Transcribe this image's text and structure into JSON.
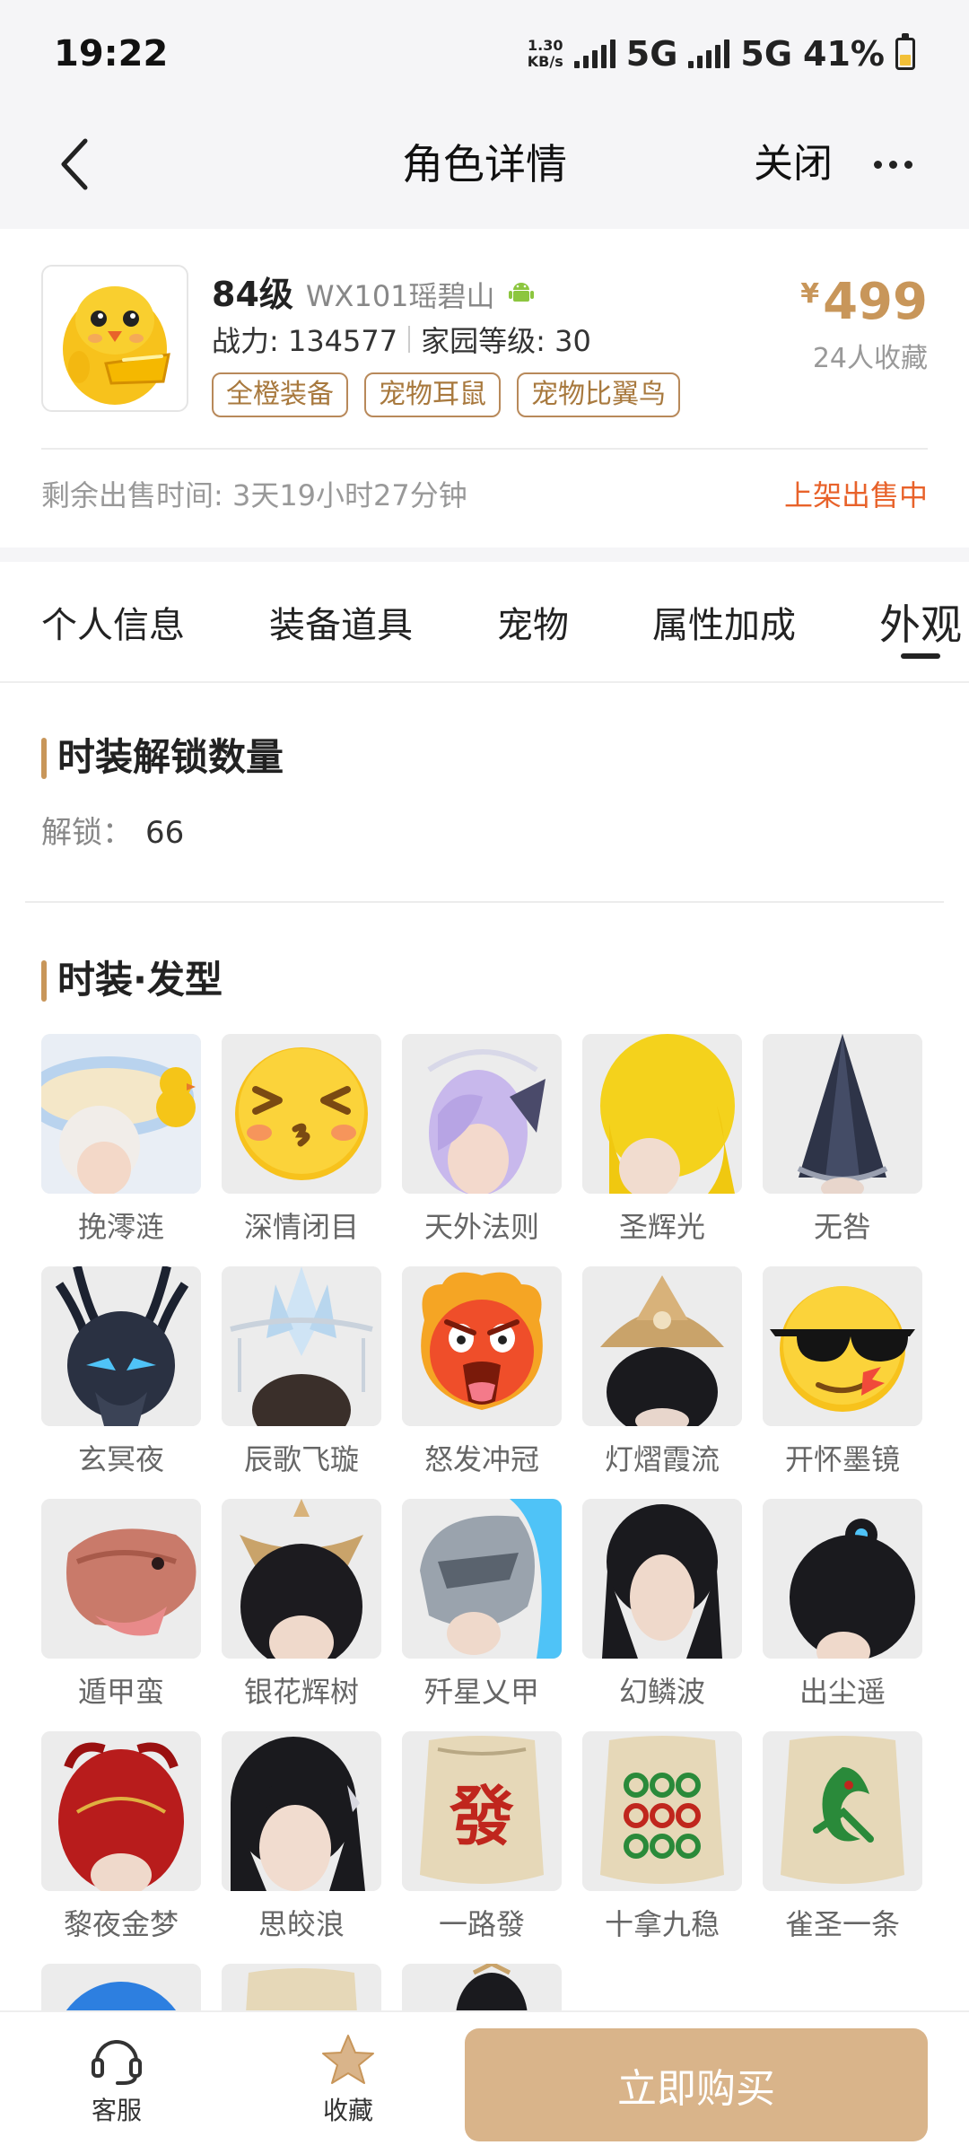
{
  "status_bar": {
    "time": "19:22",
    "net_speed_value": "1.30",
    "net_speed_unit": "KB/s",
    "network_1": "5G",
    "network_2": "5G",
    "battery": "41%"
  },
  "nav": {
    "title": "角色详情",
    "close_label": "关闭"
  },
  "character": {
    "level": "84级",
    "server": "WX101瑶碧山",
    "power": "战力: 134577",
    "home_level": "家园等级: 30",
    "tags": [
      "全橙装备",
      "宠物耳鼠",
      "宠物比翼鸟"
    ],
    "price_symbol": "¥",
    "price": "499",
    "favorites": "24人收藏",
    "remaining_time": "剩余出售时间: 3天19小时27分钟",
    "sale_status": "上架出售中"
  },
  "tabs": [
    "个人信息",
    "装备道具",
    "宠物",
    "属性加成",
    "外观"
  ],
  "active_tab": "外观",
  "unlock_section": {
    "title": "时装解锁数量",
    "label": "解锁：",
    "value": "66"
  },
  "hair_section": {
    "title": "时装·发型",
    "items": [
      "挽澪涟",
      "深情闭目",
      "天外法则",
      "圣辉光",
      "无咎",
      "玄冥夜",
      "辰歌飞璇",
      "怒发冲冠",
      "灯熠霞流",
      "开怀墨镜",
      "遁甲蛮",
      "银花辉树",
      "歼星乂甲",
      "幻鳞波",
      "出尘遥",
      "黎夜金梦",
      "思皎浪",
      "一路發",
      "十拿九稳",
      "雀圣一条"
    ]
  },
  "bottom_bar": {
    "service_label": "客服",
    "favorite_label": "收藏",
    "buy_label": "立即购买"
  },
  "colors": {
    "accent_gold": "#c8965a",
    "sale_orange": "#e8622a",
    "buy_button": "#d9b48a"
  }
}
